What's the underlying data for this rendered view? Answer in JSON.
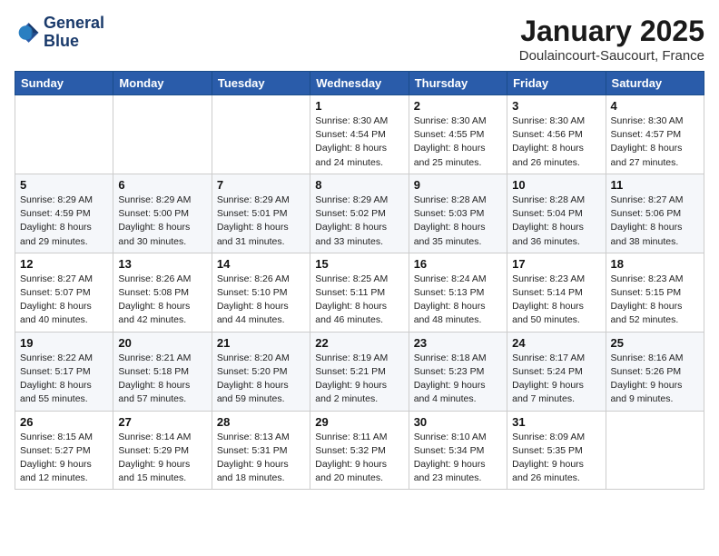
{
  "header": {
    "logo_line1": "General",
    "logo_line2": "Blue",
    "month": "January 2025",
    "location": "Doulaincourt-Saucourt, France"
  },
  "weekdays": [
    "Sunday",
    "Monday",
    "Tuesday",
    "Wednesday",
    "Thursday",
    "Friday",
    "Saturday"
  ],
  "weeks": [
    [
      {
        "day": "",
        "info": ""
      },
      {
        "day": "",
        "info": ""
      },
      {
        "day": "",
        "info": ""
      },
      {
        "day": "1",
        "info": "Sunrise: 8:30 AM\nSunset: 4:54 PM\nDaylight: 8 hours\nand 24 minutes."
      },
      {
        "day": "2",
        "info": "Sunrise: 8:30 AM\nSunset: 4:55 PM\nDaylight: 8 hours\nand 25 minutes."
      },
      {
        "day": "3",
        "info": "Sunrise: 8:30 AM\nSunset: 4:56 PM\nDaylight: 8 hours\nand 26 minutes."
      },
      {
        "day": "4",
        "info": "Sunrise: 8:30 AM\nSunset: 4:57 PM\nDaylight: 8 hours\nand 27 minutes."
      }
    ],
    [
      {
        "day": "5",
        "info": "Sunrise: 8:29 AM\nSunset: 4:59 PM\nDaylight: 8 hours\nand 29 minutes."
      },
      {
        "day": "6",
        "info": "Sunrise: 8:29 AM\nSunset: 5:00 PM\nDaylight: 8 hours\nand 30 minutes."
      },
      {
        "day": "7",
        "info": "Sunrise: 8:29 AM\nSunset: 5:01 PM\nDaylight: 8 hours\nand 31 minutes."
      },
      {
        "day": "8",
        "info": "Sunrise: 8:29 AM\nSunset: 5:02 PM\nDaylight: 8 hours\nand 33 minutes."
      },
      {
        "day": "9",
        "info": "Sunrise: 8:28 AM\nSunset: 5:03 PM\nDaylight: 8 hours\nand 35 minutes."
      },
      {
        "day": "10",
        "info": "Sunrise: 8:28 AM\nSunset: 5:04 PM\nDaylight: 8 hours\nand 36 minutes."
      },
      {
        "day": "11",
        "info": "Sunrise: 8:27 AM\nSunset: 5:06 PM\nDaylight: 8 hours\nand 38 minutes."
      }
    ],
    [
      {
        "day": "12",
        "info": "Sunrise: 8:27 AM\nSunset: 5:07 PM\nDaylight: 8 hours\nand 40 minutes."
      },
      {
        "day": "13",
        "info": "Sunrise: 8:26 AM\nSunset: 5:08 PM\nDaylight: 8 hours\nand 42 minutes."
      },
      {
        "day": "14",
        "info": "Sunrise: 8:26 AM\nSunset: 5:10 PM\nDaylight: 8 hours\nand 44 minutes."
      },
      {
        "day": "15",
        "info": "Sunrise: 8:25 AM\nSunset: 5:11 PM\nDaylight: 8 hours\nand 46 minutes."
      },
      {
        "day": "16",
        "info": "Sunrise: 8:24 AM\nSunset: 5:13 PM\nDaylight: 8 hours\nand 48 minutes."
      },
      {
        "day": "17",
        "info": "Sunrise: 8:23 AM\nSunset: 5:14 PM\nDaylight: 8 hours\nand 50 minutes."
      },
      {
        "day": "18",
        "info": "Sunrise: 8:23 AM\nSunset: 5:15 PM\nDaylight: 8 hours\nand 52 minutes."
      }
    ],
    [
      {
        "day": "19",
        "info": "Sunrise: 8:22 AM\nSunset: 5:17 PM\nDaylight: 8 hours\nand 55 minutes."
      },
      {
        "day": "20",
        "info": "Sunrise: 8:21 AM\nSunset: 5:18 PM\nDaylight: 8 hours\nand 57 minutes."
      },
      {
        "day": "21",
        "info": "Sunrise: 8:20 AM\nSunset: 5:20 PM\nDaylight: 8 hours\nand 59 minutes."
      },
      {
        "day": "22",
        "info": "Sunrise: 8:19 AM\nSunset: 5:21 PM\nDaylight: 9 hours\nand 2 minutes."
      },
      {
        "day": "23",
        "info": "Sunrise: 8:18 AM\nSunset: 5:23 PM\nDaylight: 9 hours\nand 4 minutes."
      },
      {
        "day": "24",
        "info": "Sunrise: 8:17 AM\nSunset: 5:24 PM\nDaylight: 9 hours\nand 7 minutes."
      },
      {
        "day": "25",
        "info": "Sunrise: 8:16 AM\nSunset: 5:26 PM\nDaylight: 9 hours\nand 9 minutes."
      }
    ],
    [
      {
        "day": "26",
        "info": "Sunrise: 8:15 AM\nSunset: 5:27 PM\nDaylight: 9 hours\nand 12 minutes."
      },
      {
        "day": "27",
        "info": "Sunrise: 8:14 AM\nSunset: 5:29 PM\nDaylight: 9 hours\nand 15 minutes."
      },
      {
        "day": "28",
        "info": "Sunrise: 8:13 AM\nSunset: 5:31 PM\nDaylight: 9 hours\nand 18 minutes."
      },
      {
        "day": "29",
        "info": "Sunrise: 8:11 AM\nSunset: 5:32 PM\nDaylight: 9 hours\nand 20 minutes."
      },
      {
        "day": "30",
        "info": "Sunrise: 8:10 AM\nSunset: 5:34 PM\nDaylight: 9 hours\nand 23 minutes."
      },
      {
        "day": "31",
        "info": "Sunrise: 8:09 AM\nSunset: 5:35 PM\nDaylight: 9 hours\nand 26 minutes."
      },
      {
        "day": "",
        "info": ""
      }
    ]
  ]
}
